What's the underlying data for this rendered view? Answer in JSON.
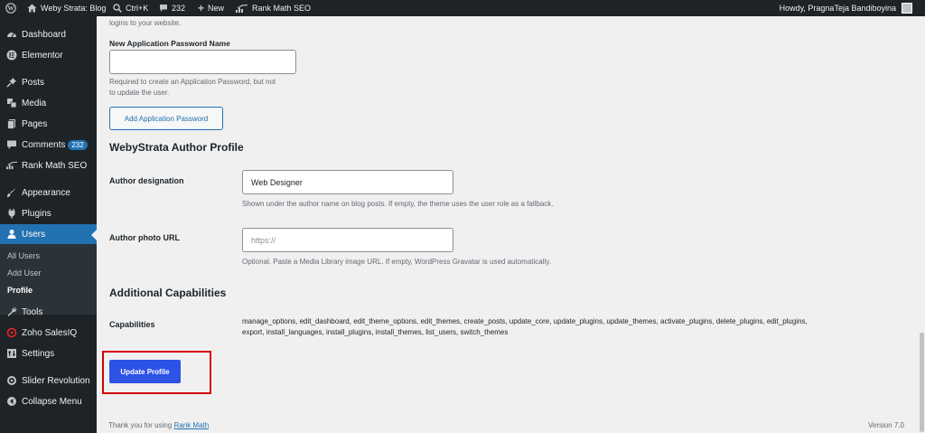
{
  "adminbar": {
    "site_name": "Weby Strata: Blog",
    "search_shortcut": "Ctrl+K",
    "comments_count": "232",
    "new_label": "New",
    "rankmath_label": "Rank Math SEO",
    "howdy": "Howdy, PragnaTeja Bandiboyina"
  },
  "sidebar": {
    "items": [
      {
        "label": "Dashboard",
        "icon": "dashboard-icon"
      },
      {
        "label": "Elementor",
        "icon": "elementor-icon"
      },
      {
        "label": "Posts",
        "icon": "pin-icon"
      },
      {
        "label": "Media",
        "icon": "media-icon"
      },
      {
        "label": "Pages",
        "icon": "pages-icon"
      },
      {
        "label": "Comments",
        "icon": "comment-icon",
        "badge": "232"
      },
      {
        "label": "Rank Math SEO",
        "icon": "rankmath-icon"
      },
      {
        "label": "Appearance",
        "icon": "brush-icon"
      },
      {
        "label": "Plugins",
        "icon": "plugin-icon"
      },
      {
        "label": "Users",
        "icon": "user-icon"
      },
      {
        "label": "Tools",
        "icon": "wrench-icon"
      },
      {
        "label": "Zoho SalesIQ",
        "icon": "zoho-icon"
      },
      {
        "label": "Settings",
        "icon": "settings-icon"
      },
      {
        "label": "Slider Revolution",
        "icon": "slider-revolution-icon"
      },
      {
        "label": "Collapse Menu",
        "icon": "collapse-icon"
      }
    ],
    "users_submenu": [
      "All Users",
      "Add User",
      "Profile"
    ]
  },
  "app_passwords": {
    "intro_tail": "logins to your website.",
    "name_label": "New Application Password Name",
    "name_value": "",
    "help": [
      "Required to create an Application Password, but not",
      "to update the user."
    ],
    "add_button": "Add Application Password"
  },
  "author_profile": {
    "heading": "WebyStrata Author Profile",
    "designation_label": "Author designation",
    "designation_value": "Web Designer",
    "designation_help": "Shown under the author name on blog posts. If empty, the theme uses the user role as a fallback.",
    "photo_label": "Author photo URL",
    "photo_placeholder": "https://",
    "photo_help": "Optional. Paste a Media Library image URL. If empty, WordPress Gravatar is used automatically."
  },
  "capabilities": {
    "heading": "Additional Capabilities",
    "label": "Capabilities",
    "line1": "manage_options, edit_dashboard, edit_theme_options, edit_themes, create_posts, update_core, update_plugins, update_themes, activate_plugins, delete_plugins, edit_plugins,",
    "line2": "export, install_languages, install_plugins, install_themes, list_users, switch_themes"
  },
  "update_button": "Update Profile",
  "footer": {
    "thanks": "Thank you for using",
    "link": "Rank Math",
    "version": "Version 7.0"
  }
}
